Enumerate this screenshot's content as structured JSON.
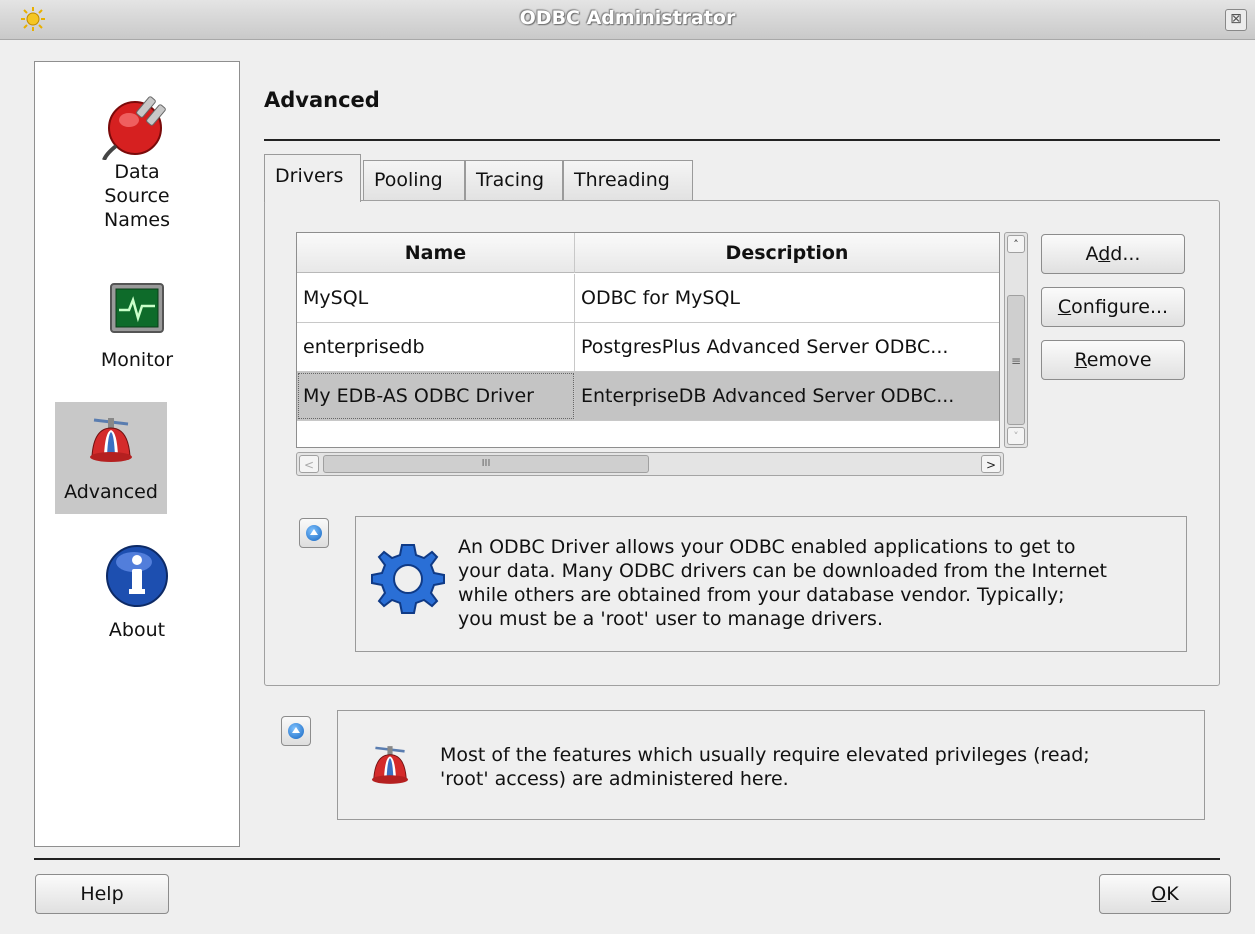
{
  "window": {
    "title": "ODBC Administrator",
    "close_glyph": "⊠"
  },
  "sidebar": {
    "items": [
      {
        "icon": "plug-icon",
        "label_lines": [
          "Data",
          "Source",
          "Names"
        ]
      },
      {
        "icon": "monitor-icon",
        "label": "Monitor"
      },
      {
        "icon": "propeller-hat-icon",
        "label": "Advanced",
        "selected": true
      },
      {
        "icon": "info-icon",
        "label": "About"
      }
    ]
  },
  "page": {
    "title": "Advanced"
  },
  "tabs": [
    {
      "label": "Drivers",
      "active": true
    },
    {
      "label": "Pooling"
    },
    {
      "label": "Tracing"
    },
    {
      "label": "Threading"
    }
  ],
  "drivers_table": {
    "columns": [
      "Name",
      "Description"
    ],
    "rows": [
      {
        "name": "MySQL",
        "description": "ODBC for MySQL"
      },
      {
        "name": "enterprisedb",
        "description": "PostgresPlus Advanced Server ODBC..."
      },
      {
        "name": "My EDB-AS ODBC Driver",
        "description": "EnterpriseDB Advanced Server ODBC...",
        "selected": true
      }
    ]
  },
  "scrollbars": {
    "v_up": "˄",
    "v_down": "˅",
    "v_grip": "≡",
    "h_left": "<",
    "h_right": ">",
    "h_grip": "III"
  },
  "buttons": {
    "add": {
      "pre": "A",
      "mnemonic": "d",
      "post": "d..."
    },
    "configure": {
      "pre": "",
      "mnemonic": "C",
      "post": "onfigure..."
    },
    "remove": {
      "pre": "",
      "mnemonic": "R",
      "post": "emove"
    },
    "help": "Help",
    "ok": {
      "pre": "",
      "mnemonic": "O",
      "post": "K"
    }
  },
  "drivers_info": {
    "lines": [
      "An ODBC Driver allows your ODBC enabled applications to get to",
      "your data. Many ODBC drivers can be downloaded from the Internet",
      "while others are obtained from your database vendor. Typically;",
      "you must be a 'root' user to manage drivers."
    ]
  },
  "advanced_info": {
    "lines": [
      "Most of the features which usually require elevated privileges (read;",
      "'root' access) are administered here."
    ]
  },
  "colors": {
    "selected_row": "#c4c4c4",
    "sidebar_selected": "#c8c8c8",
    "info_dot": "#1565c0"
  }
}
